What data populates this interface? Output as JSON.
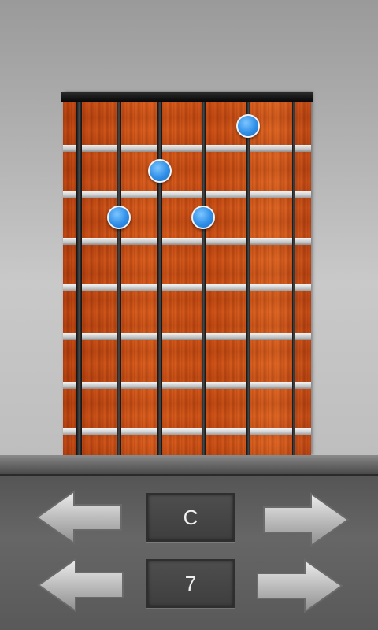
{
  "chord": {
    "root_label": "C",
    "variant_label": "7"
  },
  "fretboard": {
    "strings": 6,
    "frets_shown": 7,
    "finger_positions": [
      {
        "string": 5,
        "fret": 1
      },
      {
        "string": 3,
        "fret": 2
      },
      {
        "string": 2,
        "fret": 3
      },
      {
        "string": 4,
        "fret": 3
      }
    ],
    "dot_color": "#2f8fe8",
    "wood_color": "#d05018"
  },
  "controls": {
    "root_prev_icon": "left-arrow-icon",
    "root_next_icon": "right-arrow-icon",
    "variant_prev_icon": "left-arrow-icon",
    "variant_next_icon": "right-arrow-icon"
  }
}
